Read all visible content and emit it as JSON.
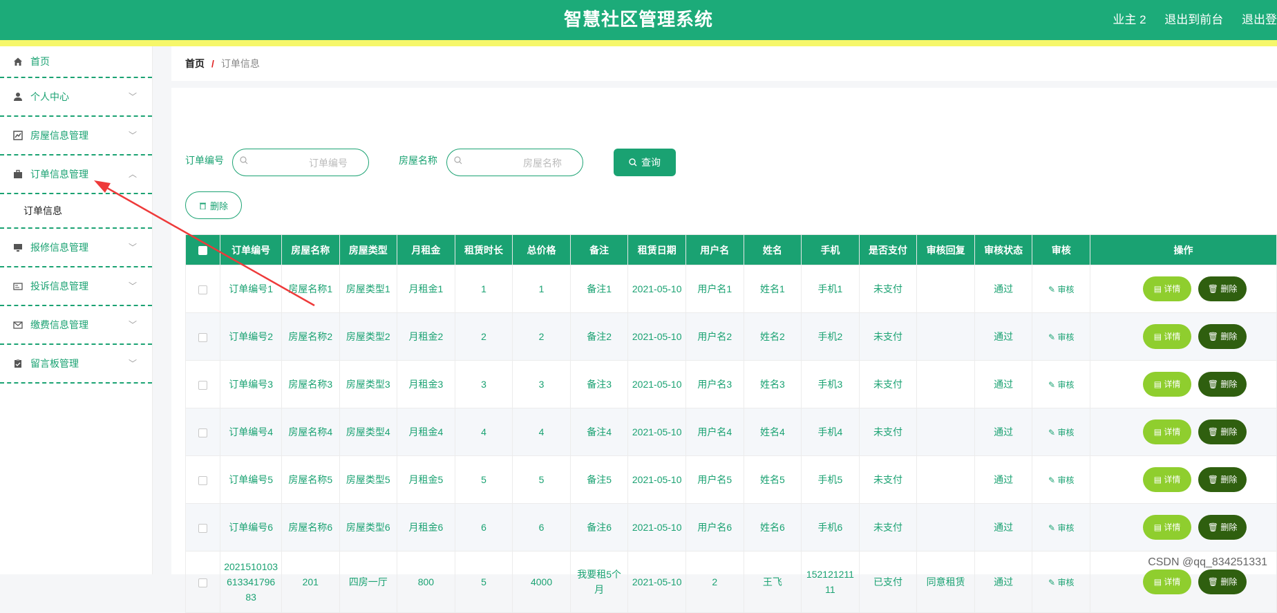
{
  "header": {
    "title": "智慧社区管理系统",
    "user": "业主 2",
    "front_link": "退出到前台",
    "logout": "退出登"
  },
  "colors": {
    "brand": "#1cab79",
    "stripe": "#f6f76a",
    "detail": "#8fce2e",
    "delete": "#2f5f0f"
  },
  "sidebar": {
    "items": [
      {
        "label": "首页",
        "icon": "home-icon"
      },
      {
        "label": "个人中心",
        "icon": "user-icon"
      },
      {
        "label": "房屋信息管理",
        "icon": "chart-icon"
      },
      {
        "label": "订单信息管理",
        "icon": "briefcase-icon"
      },
      {
        "label": "报修信息管理",
        "icon": "monitor-icon"
      },
      {
        "label": "投诉信息管理",
        "icon": "id-card-icon"
      },
      {
        "label": "缴费信息管理",
        "icon": "mail-icon"
      },
      {
        "label": "留言板管理",
        "icon": "clipboard-icon"
      }
    ],
    "submenu": "订单信息"
  },
  "breadcrumb": {
    "home": "首页",
    "sep": "/",
    "current": "订单信息"
  },
  "search": {
    "order_label": "订单编号",
    "order_placeholder": "订单编号",
    "house_label": "房屋名称",
    "house_placeholder": "房屋名称",
    "query": "查询"
  },
  "delete_button": "删除",
  "table": {
    "headers": [
      "订单编号",
      "房屋名称",
      "房屋类型",
      "月租金",
      "租赁时长",
      "总价格",
      "备注",
      "租赁日期",
      "用户名",
      "姓名",
      "手机",
      "是否支付",
      "审核回复",
      "审核状态",
      "审核",
      "操作"
    ],
    "review_label": "审核",
    "detail_label": "详情",
    "delete_label": "删除",
    "rows": [
      [
        "订单编号1",
        "房屋名称1",
        "房屋类型1",
        "月租金1",
        "1",
        "1",
        "备注1",
        "2021-05-10",
        "用户名1",
        "姓名1",
        "手机1",
        "未支付",
        "",
        "通过"
      ],
      [
        "订单编号2",
        "房屋名称2",
        "房屋类型2",
        "月租金2",
        "2",
        "2",
        "备注2",
        "2021-05-10",
        "用户名2",
        "姓名2",
        "手机2",
        "未支付",
        "",
        "通过"
      ],
      [
        "订单编号3",
        "房屋名称3",
        "房屋类型3",
        "月租金3",
        "3",
        "3",
        "备注3",
        "2021-05-10",
        "用户名3",
        "姓名3",
        "手机3",
        "未支付",
        "",
        "通过"
      ],
      [
        "订单编号4",
        "房屋名称4",
        "房屋类型4",
        "月租金4",
        "4",
        "4",
        "备注4",
        "2021-05-10",
        "用户名4",
        "姓名4",
        "手机4",
        "未支付",
        "",
        "通过"
      ],
      [
        "订单编号5",
        "房屋名称5",
        "房屋类型5",
        "月租金5",
        "5",
        "5",
        "备注5",
        "2021-05-10",
        "用户名5",
        "姓名5",
        "手机5",
        "未支付",
        "",
        "通过"
      ],
      [
        "订单编号6",
        "房屋名称6",
        "房屋类型6",
        "月租金6",
        "6",
        "6",
        "备注6",
        "2021-05-10",
        "用户名6",
        "姓名6",
        "手机6",
        "未支付",
        "",
        "通过"
      ],
      [
        "2021510103613341796 83",
        "201",
        "四房一厅",
        "800",
        "5",
        "4000",
        "我要租5个月",
        "2021-05-10",
        "2",
        "王飞",
        "15212121111",
        "已支付",
        "同意租赁",
        "通过"
      ]
    ]
  },
  "watermark": "CSDN @qq_834251331"
}
